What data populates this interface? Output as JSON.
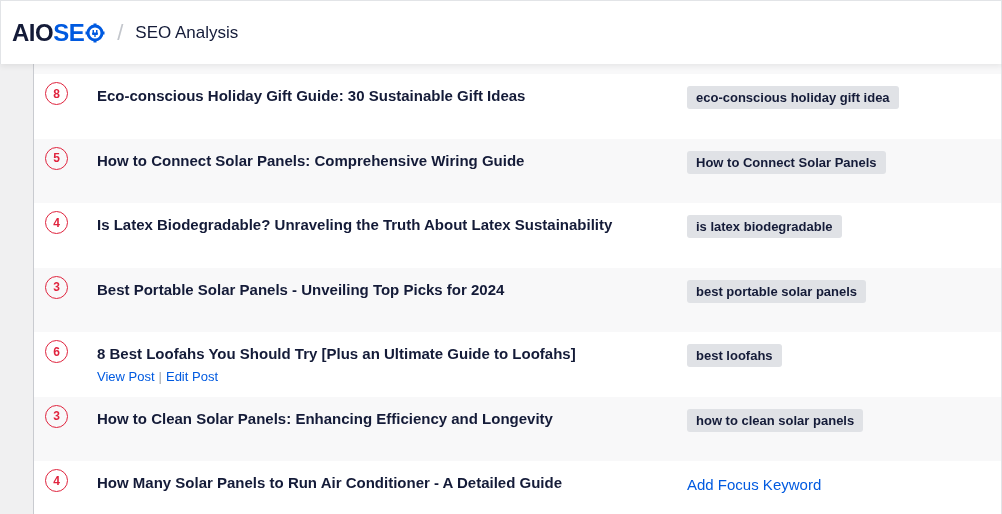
{
  "header": {
    "logo": {
      "dark": "AIO",
      "accent": "SE"
    },
    "separator": "/",
    "title": "SEO Analysis"
  },
  "action_separator": "|",
  "rows": [
    {
      "score": "8",
      "title": "Eco-conscious Holiday Gift Guide: 30 Sustainable Gift Ideas",
      "keyword": {
        "kind": "tag",
        "text": "eco-conscious holiday gift idea"
      }
    },
    {
      "score": "5",
      "title": "How to Connect Solar Panels: Comprehensive Wiring Guide",
      "keyword": {
        "kind": "tag",
        "text": "How to Connect Solar Panels"
      }
    },
    {
      "score": "4",
      "title": "Is Latex Biodegradable? Unraveling the Truth About Latex Sustainability",
      "keyword": {
        "kind": "tag",
        "text": "is latex biodegradable"
      }
    },
    {
      "score": "3",
      "title": "Best Portable Solar Panels - Unveiling Top Picks for 2024",
      "keyword": {
        "kind": "tag",
        "text": "best portable solar panels"
      }
    },
    {
      "score": "6",
      "title": "8 Best Loofahs You Should Try [Plus an Ultimate Guide to Loofahs]",
      "actions": [
        "View Post",
        "Edit Post"
      ],
      "keyword": {
        "kind": "tag",
        "text": "best loofahs"
      }
    },
    {
      "score": "3",
      "title": "How to Clean Solar Panels: Enhancing Efficiency and Longevity",
      "keyword": {
        "kind": "tag",
        "text": "how to clean solar panels"
      }
    },
    {
      "score": "4",
      "title": "How Many Solar Panels to Run Air Conditioner - A Detailed Guide",
      "keyword": {
        "kind": "link",
        "text": "Add Focus Keyword"
      }
    }
  ]
}
